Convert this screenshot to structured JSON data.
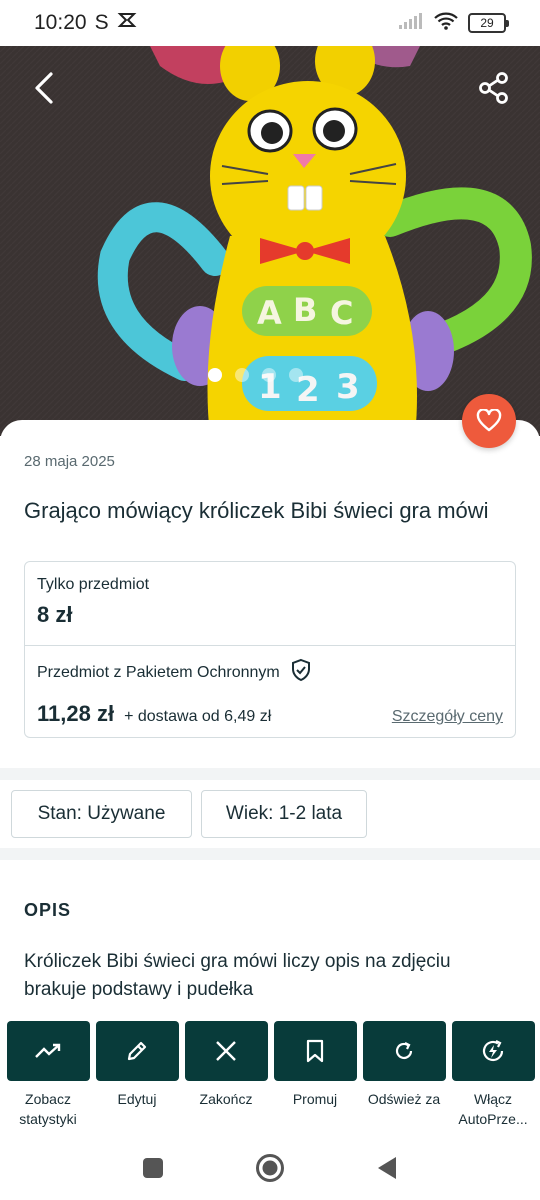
{
  "status_bar": {
    "time": "10:20",
    "carrier_glyph": "S",
    "battery": "29"
  },
  "hero": {
    "image_dots_count": 4,
    "active_dot": 0
  },
  "listing": {
    "date": "28 maja 2025",
    "title": "Grająco mówiący króliczek Bibi świeci gra mówi",
    "item_only_label": "Tylko przedmiot",
    "item_only_price": "8 zł",
    "protection_label": "Przedmiot z Pakietem Ochronnym",
    "total_price": "11,28 zł",
    "shipping": "+ dostawa od 6,49 zł",
    "price_details_link": "Szczegóły ceny"
  },
  "attributes": {
    "condition": "Stan: Używane",
    "age": "Wiek: 1-2 lata"
  },
  "description": {
    "heading": "OPIS",
    "text": "Króliczek Bibi świeci gra mówi liczy opis na zdjęciu brakuje podstawy i pudełka"
  },
  "actions": [
    {
      "label": "Zobacz statystyki",
      "icon": "trend-up-icon"
    },
    {
      "label": "Edytuj",
      "icon": "pencil-icon"
    },
    {
      "label": "Zakończ",
      "icon": "close-icon"
    },
    {
      "label": "Promuj",
      "icon": "bookmark-icon"
    },
    {
      "label": "Odśwież za",
      "icon": "refresh-icon"
    },
    {
      "label": "Włącz AutoPrze...",
      "icon": "auto-bolt-icon"
    }
  ],
  "colors": {
    "accent_dark": "#083b3a",
    "favorite": "#ee5a3c",
    "text": "#1a2e35"
  }
}
